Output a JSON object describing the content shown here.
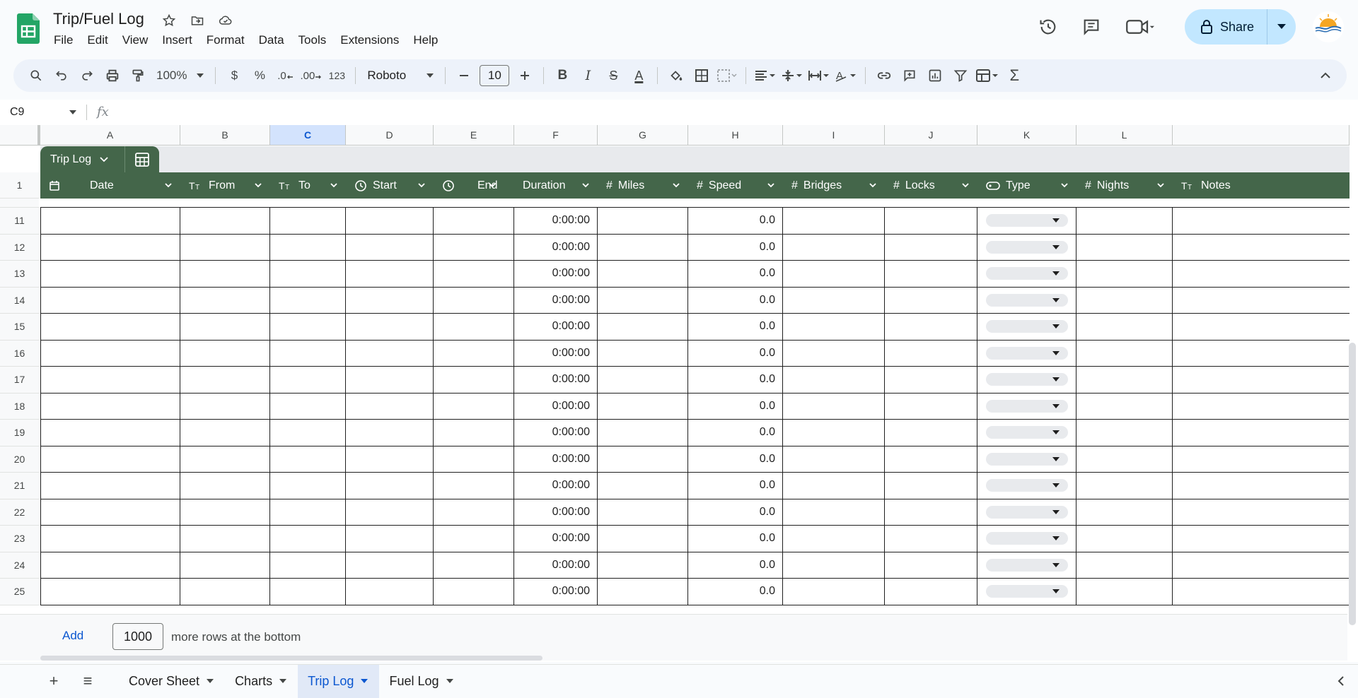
{
  "doc": {
    "title": "Trip/Fuel Log",
    "menu": [
      "File",
      "Edit",
      "View",
      "Insert",
      "Format",
      "Data",
      "Tools",
      "Extensions",
      "Help"
    ],
    "share_label": "Share"
  },
  "toolbar": {
    "zoom": "100%",
    "currency": "$",
    "percent": "%",
    "dec_decrease": ".0",
    "dec_increase": ".00",
    "number_format": "123",
    "font": "Roboto",
    "font_size": "10"
  },
  "formula_bar": {
    "cell_ref": "C9",
    "fx": "fx",
    "value": ""
  },
  "columns": [
    "A",
    "B",
    "C",
    "D",
    "E",
    "F",
    "G",
    "H",
    "I",
    "J",
    "K",
    "L"
  ],
  "selected_column": "C",
  "table": {
    "name": "Trip Log",
    "header_row_number": "1",
    "headers": [
      {
        "label": "Date",
        "icon": "calendar-icon"
      },
      {
        "label": "From",
        "icon": "text-type-icon"
      },
      {
        "label": "To",
        "icon": "text-type-icon"
      },
      {
        "label": "Start",
        "icon": "clock-icon"
      },
      {
        "label": "End",
        "icon": "clock-icon"
      },
      {
        "label": "Duration",
        "icon": ""
      },
      {
        "label": "Miles",
        "icon": "number-icon"
      },
      {
        "label": "Speed",
        "icon": "number-icon"
      },
      {
        "label": "Bridges",
        "icon": "number-icon"
      },
      {
        "label": "Locks",
        "icon": "number-icon"
      },
      {
        "label": "Type",
        "icon": "dropdown-chip-icon"
      },
      {
        "label": "Nights",
        "icon": "number-icon"
      },
      {
        "label": "Notes",
        "icon": "text-type-icon"
      }
    ],
    "rows": [
      {
        "num": "11",
        "duration": "0:00:00",
        "speed": "0.0"
      },
      {
        "num": "12",
        "duration": "0:00:00",
        "speed": "0.0"
      },
      {
        "num": "13",
        "duration": "0:00:00",
        "speed": "0.0"
      },
      {
        "num": "14",
        "duration": "0:00:00",
        "speed": "0.0"
      },
      {
        "num": "15",
        "duration": "0:00:00",
        "speed": "0.0"
      },
      {
        "num": "16",
        "duration": "0:00:00",
        "speed": "0.0"
      },
      {
        "num": "17",
        "duration": "0:00:00",
        "speed": "0.0"
      },
      {
        "num": "18",
        "duration": "0:00:00",
        "speed": "0.0"
      },
      {
        "num": "19",
        "duration": "0:00:00",
        "speed": "0.0"
      },
      {
        "num": "20",
        "duration": "0:00:00",
        "speed": "0.0"
      },
      {
        "num": "21",
        "duration": "0:00:00",
        "speed": "0.0"
      },
      {
        "num": "22",
        "duration": "0:00:00",
        "speed": "0.0"
      },
      {
        "num": "23",
        "duration": "0:00:00",
        "speed": "0.0"
      },
      {
        "num": "24",
        "duration": "0:00:00",
        "speed": "0.0"
      },
      {
        "num": "25",
        "duration": "0:00:00",
        "speed": "0.0"
      }
    ]
  },
  "add_rows": {
    "add_label": "Add",
    "count": "1000",
    "suffix": "more rows at the bottom"
  },
  "sheets": [
    {
      "label": "Cover Sheet",
      "active": false
    },
    {
      "label": "Charts",
      "active": false
    },
    {
      "label": "Trip Log",
      "active": true
    },
    {
      "label": "Fuel Log",
      "active": false
    }
  ],
  "colors": {
    "table_header": "#44664a",
    "accent": "#0b57d0",
    "share_bg": "#c2e7ff"
  }
}
